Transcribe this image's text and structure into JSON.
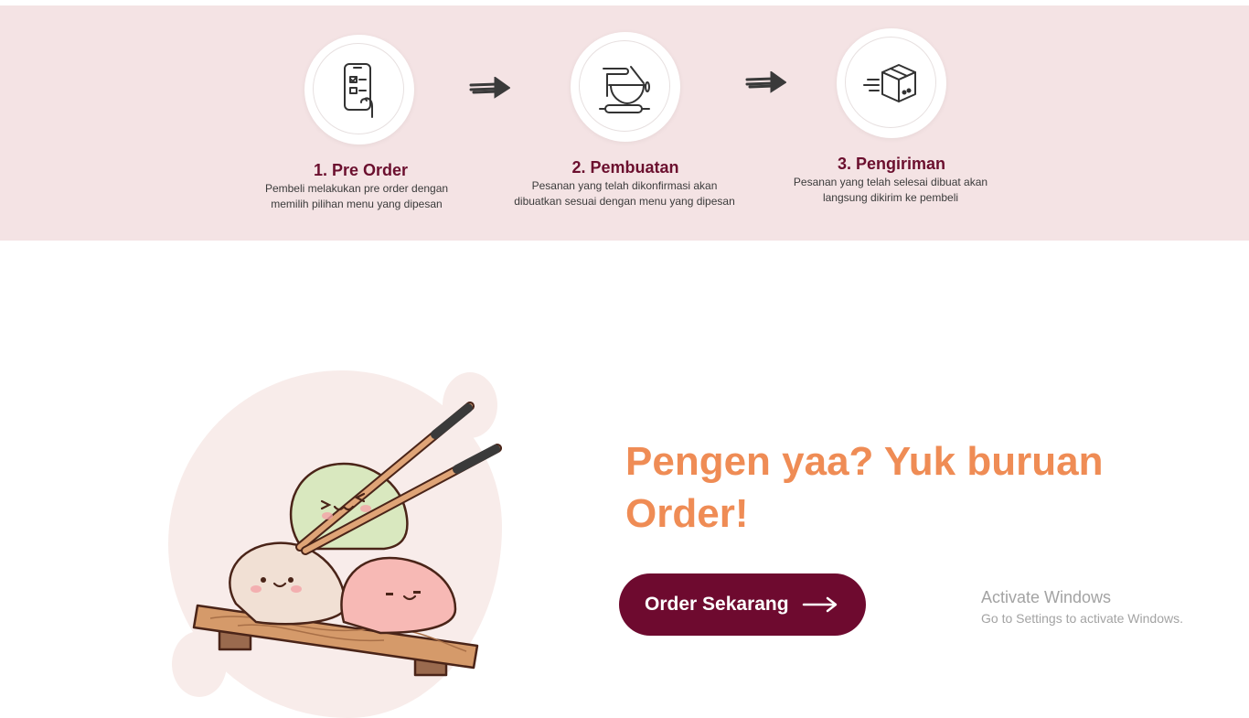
{
  "steps": [
    {
      "title": "1. Pre Order",
      "desc_line1": "Pembeli melakukan pre order dengan",
      "desc_line2": "memilih pilihan menu yang dipesan",
      "icon": "phone-checklist-icon"
    },
    {
      "title": "2. Pembuatan",
      "desc_line1": "Pesanan yang telah dikonfirmasi akan",
      "desc_line2": "dibuatkan sesuai dengan menu yang dipesan",
      "icon": "baking-bowl-icon"
    },
    {
      "title": "3. Pengiriman",
      "desc_line1": "Pesanan yang telah selesai dibuat akan",
      "desc_line2": "langsung dikirim ke pembeli",
      "icon": "delivery-box-icon"
    }
  ],
  "cta": {
    "heading_line1": "Pengen yaa? Yuk buruan",
    "heading_line2": "Order!",
    "button_label": "Order Sekarang"
  },
  "watermark": {
    "title": "Activate Windows",
    "subtitle": "Go to Settings to activate Windows."
  },
  "colors": {
    "band_bg": "#f4e3e4",
    "title_maroon": "#6b0f2e",
    "heading_orange": "#ef8c55",
    "button_bg": "#6e0a2f"
  }
}
